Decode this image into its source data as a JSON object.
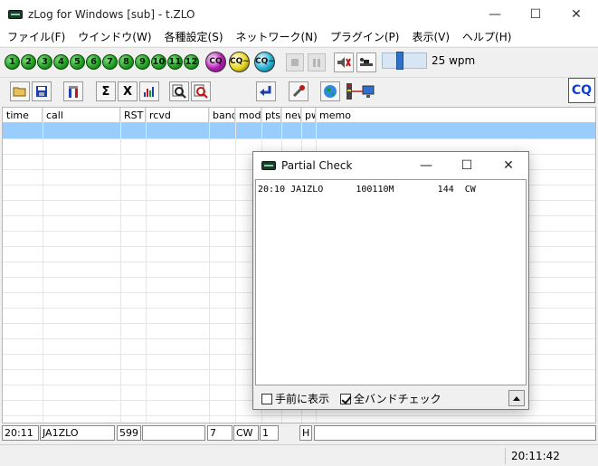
{
  "window": {
    "title": "zLog for Windows  [sub] - t.ZLO",
    "min_glyph": "—",
    "max_glyph": "☐",
    "close_glyph": "✕"
  },
  "menu": [
    "ファイル(F)",
    "ウインドウ(W)",
    "各種設定(S)",
    "ネットワーク(N)",
    "プラグイン(P)",
    "表示(V)",
    "ヘルプ(H)"
  ],
  "toolbar": {
    "memory_buttons": [
      "1",
      "2",
      "3",
      "4",
      "5",
      "6",
      "7",
      "8",
      "9",
      "10",
      "11",
      "12"
    ],
    "cq_buttons": [
      {
        "label": "CQ",
        "color": "#b516b5"
      },
      {
        "label": "CQ~",
        "color": "#e8d618"
      },
      {
        "label": "CQ~",
        "color": "#1fb2d6"
      }
    ],
    "wpm_label": "25 wpm",
    "speed_fraction": 0.38
  },
  "toolbar2": {
    "sigma": "Σ",
    "x": "X",
    "cq_label": "CQ"
  },
  "grid": {
    "columns": [
      "time",
      "call",
      "RST",
      "rcvd",
      "band",
      "mod",
      "pts",
      "new",
      "pwr",
      "memo"
    ]
  },
  "entry": {
    "time": "20:11",
    "call": "JA1ZLO",
    "rst": "599",
    "rcvd": "",
    "band": "7",
    "mode": "CW",
    "power": "1",
    "op": "H",
    "memo": ""
  },
  "status": {
    "clock": "20:11:42"
  },
  "partial_check": {
    "title": "Partial Check",
    "line": "20:10 JA1ZLO      100110M        144  CW",
    "stay_on_top_label": "手前に表示",
    "stay_on_top": false,
    "all_bands_label": "全バンドチェック",
    "all_bands": true
  }
}
